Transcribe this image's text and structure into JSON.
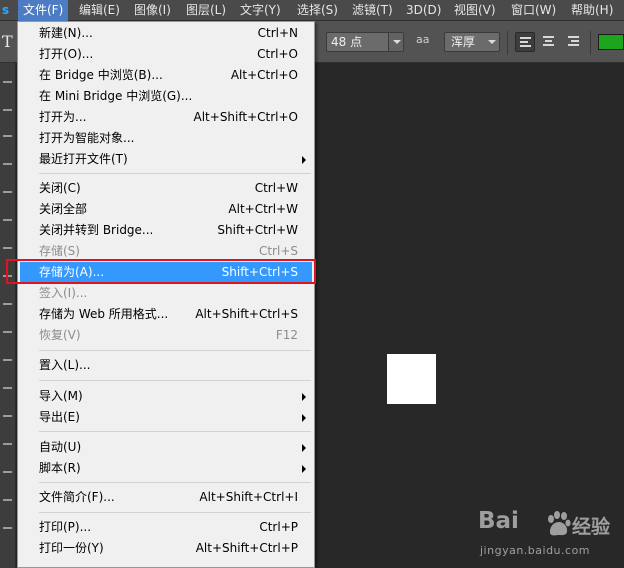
{
  "app": {
    "logo_letter": "s"
  },
  "menubar": {
    "items": [
      {
        "label": "文件(F)"
      },
      {
        "label": "编辑(E)"
      },
      {
        "label": "图像(I)"
      },
      {
        "label": "图层(L)"
      },
      {
        "label": "文字(Y)"
      },
      {
        "label": "选择(S)"
      },
      {
        "label": "滤镜(T)"
      },
      {
        "label": "3D(D)"
      },
      {
        "label": "视图(V)"
      },
      {
        "label": "窗口(W)"
      },
      {
        "label": "帮助(H)"
      }
    ],
    "active_index": 0
  },
  "options": {
    "tool_glyph": "T",
    "font_size": "48 点",
    "antialias_icon": "aa",
    "antialias_value": "浑厚",
    "text_color": "#1ea51e"
  },
  "file_menu": {
    "items": [
      {
        "label": "新建(N)...",
        "shortcut": "Ctrl+N"
      },
      {
        "label": "打开(O)...",
        "shortcut": "Ctrl+O"
      },
      {
        "label": "在 Bridge 中浏览(B)...",
        "shortcut": "Alt+Ctrl+O"
      },
      {
        "label": "在 Mini Bridge 中浏览(G)...",
        "shortcut": ""
      },
      {
        "label": "打开为...",
        "shortcut": "Alt+Shift+Ctrl+O"
      },
      {
        "label": "打开为智能对象...",
        "shortcut": ""
      },
      {
        "label": "最近打开文件(T)",
        "shortcut": "",
        "submenu": true
      },
      {
        "label": "关闭(C)",
        "shortcut": "Ctrl+W"
      },
      {
        "label": "关闭全部",
        "shortcut": "Alt+Ctrl+W"
      },
      {
        "label": "关闭并转到 Bridge...",
        "shortcut": "Shift+Ctrl+W"
      },
      {
        "label": "存储(S)",
        "shortcut": "Ctrl+S",
        "disabled": true
      },
      {
        "label": "存储为(A)...",
        "shortcut": "Shift+Ctrl+S",
        "highlighted": true
      },
      {
        "label": "签入(I)...",
        "shortcut": "",
        "disabled": true
      },
      {
        "label": "存储为 Web 所用格式...",
        "shortcut": "Alt+Shift+Ctrl+S"
      },
      {
        "label": "恢复(V)",
        "shortcut": "F12",
        "disabled": true
      },
      {
        "label": "置入(L)...",
        "shortcut": ""
      },
      {
        "label": "导入(M)",
        "shortcut": "",
        "submenu": true
      },
      {
        "label": "导出(E)",
        "shortcut": "",
        "submenu": true
      },
      {
        "label": "自动(U)",
        "shortcut": "",
        "submenu": true
      },
      {
        "label": "脚本(R)",
        "shortcut": "",
        "submenu": true
      },
      {
        "label": "文件简介(F)...",
        "shortcut": "Alt+Shift+Ctrl+I"
      },
      {
        "label": "打印(P)...",
        "shortcut": "Ctrl+P"
      },
      {
        "label": "打印一份(Y)",
        "shortcut": "Alt+Shift+Ctrl+P"
      }
    ]
  },
  "watermark": {
    "logo_text": "Bai",
    "brand_cn": "经验",
    "url": "jingyan.baidu.com"
  },
  "colors": {
    "highlight": "#3399ff",
    "annotation_box": "#e0141c",
    "menubar_active": "#4c7dc4"
  }
}
